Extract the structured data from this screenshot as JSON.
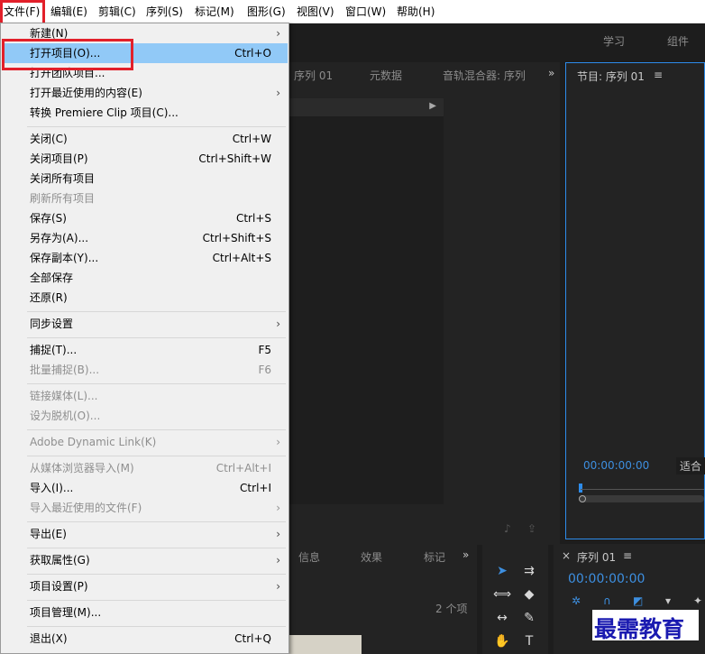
{
  "menubar": {
    "items": [
      "文件(F)",
      "编辑(E)",
      "剪辑(C)",
      "序列(S)",
      "标记(M)",
      "图形(G)",
      "视图(V)",
      "窗口(W)",
      "帮助(H)"
    ]
  },
  "header": {
    "learn": "学习",
    "assembly": "组件"
  },
  "source_panel": {
    "tabs": [
      "序列 01",
      "元数据",
      "音轨混合器: 序列"
    ],
    "more": "»"
  },
  "program_panel": {
    "title": "节目: 序列 01",
    "menu_icon": "≡",
    "timecode": "00:00:00:00",
    "fit": "适合"
  },
  "project_panel": {
    "tabs": [
      "信息",
      "效果",
      "标记"
    ],
    "more": "»",
    "item_count": "2 个项"
  },
  "timeline_panel": {
    "close": "×",
    "title": "序列 01",
    "menu_icon": "≡",
    "timecode": "00:00:00:00"
  },
  "watermark": "最需教育",
  "file_menu": {
    "items": [
      {
        "label": "新建(N)",
        "shortcut": "",
        "submenu": true,
        "disabled": false
      },
      {
        "label": "打开项目(O)...",
        "shortcut": "Ctrl+O",
        "submenu": false,
        "disabled": false,
        "highlighted": true
      },
      {
        "label": "打开团队项目...",
        "shortcut": "",
        "submenu": false,
        "disabled": false
      },
      {
        "label": "打开最近使用的内容(E)",
        "shortcut": "",
        "submenu": true,
        "disabled": false
      },
      {
        "label": "转换 Premiere Clip 项目(C)...",
        "shortcut": "",
        "submenu": false,
        "disabled": false
      },
      {
        "label": "关闭(C)",
        "shortcut": "Ctrl+W",
        "submenu": false,
        "disabled": false
      },
      {
        "label": "关闭项目(P)",
        "shortcut": "Ctrl+Shift+W",
        "submenu": false,
        "disabled": false
      },
      {
        "label": "关闭所有项目",
        "shortcut": "",
        "submenu": false,
        "disabled": false
      },
      {
        "label": "刷新所有项目",
        "shortcut": "",
        "submenu": false,
        "disabled": true
      },
      {
        "label": "保存(S)",
        "shortcut": "Ctrl+S",
        "submenu": false,
        "disabled": false
      },
      {
        "label": "另存为(A)...",
        "shortcut": "Ctrl+Shift+S",
        "submenu": false,
        "disabled": false
      },
      {
        "label": "保存副本(Y)...",
        "shortcut": "Ctrl+Alt+S",
        "submenu": false,
        "disabled": false
      },
      {
        "label": "全部保存",
        "shortcut": "",
        "submenu": false,
        "disabled": false
      },
      {
        "label": "还原(R)",
        "shortcut": "",
        "submenu": false,
        "disabled": false
      },
      {
        "label": "同步设置",
        "shortcut": "",
        "submenu": true,
        "disabled": false
      },
      {
        "label": "捕捉(T)...",
        "shortcut": "F5",
        "submenu": false,
        "disabled": false
      },
      {
        "label": "批量捕捉(B)...",
        "shortcut": "F6",
        "submenu": false,
        "disabled": true
      },
      {
        "label": "链接媒体(L)...",
        "shortcut": "",
        "submenu": false,
        "disabled": true
      },
      {
        "label": "设为脱机(O)...",
        "shortcut": "",
        "submenu": false,
        "disabled": true
      },
      {
        "label": "Adobe Dynamic Link(K)",
        "shortcut": "",
        "submenu": true,
        "disabled": true
      },
      {
        "label": "从媒体浏览器导入(M)",
        "shortcut": "Ctrl+Alt+I",
        "submenu": false,
        "disabled": true
      },
      {
        "label": "导入(I)...",
        "shortcut": "Ctrl+I",
        "submenu": false,
        "disabled": false
      },
      {
        "label": "导入最近使用的文件(F)",
        "shortcut": "",
        "submenu": true,
        "disabled": true
      },
      {
        "label": "导出(E)",
        "shortcut": "",
        "submenu": true,
        "disabled": false
      },
      {
        "label": "获取属性(G)",
        "shortcut": "",
        "submenu": true,
        "disabled": false
      },
      {
        "label": "项目设置(P)",
        "shortcut": "",
        "submenu": true,
        "disabled": false
      },
      {
        "label": "项目管理(M)...",
        "shortcut": "",
        "submenu": false,
        "disabled": false
      },
      {
        "label": "退出(X)",
        "shortcut": "Ctrl+Q",
        "submenu": false,
        "disabled": false
      }
    ]
  },
  "colors": {
    "menu_bg": "#f0f0f0",
    "highlight": "#91c9f7",
    "red_annotation": "#e2202a",
    "timecode_blue": "#3d8fe0",
    "app_bg": "#1d1d1d"
  }
}
